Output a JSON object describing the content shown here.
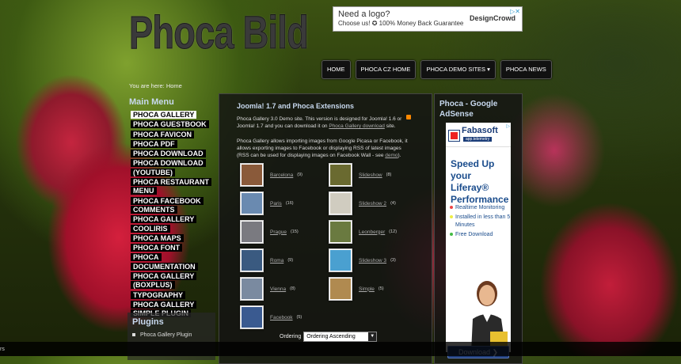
{
  "site": {
    "logo": "Phoca Bild"
  },
  "topad": {
    "line1": "Need a logo?",
    "line2": "Choose us! ✪ 100% Money Back Guarantee",
    "brand": "DesignCrowd",
    "ad_mark": "▷✕"
  },
  "nav": {
    "items": [
      "HOME",
      "PHOCA CZ HOME",
      "PHOCA DEMO SITES ▾",
      "PHOCA NEWS"
    ]
  },
  "breadcrumb": "You are here: Home",
  "mainmenu": {
    "title": "Main Menu",
    "items": [
      "PHOCA GALLERY",
      "PHOCA GUESTBOOK",
      "PHOCA FAVICON",
      "PHOCA PDF",
      "PHOCA DOWNLOAD",
      "PHOCA DOWNLOAD (YOUTUBE)",
      "PHOCA RESTAURANT MENU",
      "PHOCA FACEBOOK COMMENTS",
      "PHOCA GALLERY COOLIRIS",
      "PHOCA MAPS",
      "PHOCA FONT",
      "PHOCA DOCUMENTATION",
      "PHOCA GALLERY (BOXPLUS)",
      "TYPOGRAPHY",
      "PHOCA GALLERY SIMPLE PLUGIN"
    ]
  },
  "plugins": {
    "title": "Plugins",
    "item": "Phoca Gallery Plugin"
  },
  "content": {
    "title": "Joomla! 1.7 and Phoca Extensions",
    "p1": "Phoca Gallery 3.0 Demo site. This version is designed for Joomla! 1.6 or Joomla! 1.7 and you can download it on ",
    "p1_link": "Phoca Gallery download",
    "p1_end": " site.",
    "p2": "Phoca Gallery allows importing images from Google Picasa or Facebook, it allows exporting images to Facebook or displaying RSS of latest images (RSS can be used for displaying images on Facebook Wall - see ",
    "p2_link": "demo",
    "p2_end": ").",
    "categories": [
      {
        "name": "Barcelona",
        "count": "(9)",
        "color": "#8a5a3a"
      },
      {
        "name": "Slideshow",
        "count": "(8)",
        "color": "#6a6a30"
      },
      {
        "name": "Paris",
        "count": "(16)",
        "color": "#6a8ab0"
      },
      {
        "name": "Slideshow 2",
        "count": "(4)",
        "color": "#d0ccc0"
      },
      {
        "name": "Prague",
        "count": "(15)",
        "color": "#7a7a80"
      },
      {
        "name": "Leonberger",
        "count": "(12)",
        "color": "#6a7a40"
      },
      {
        "name": "Roma",
        "count": "(9)",
        "color": "#3a5a80"
      },
      {
        "name": "Slideshow 3",
        "count": "(3)",
        "color": "#4aa0d0"
      },
      {
        "name": "Vienna",
        "count": "(8)",
        "color": "#7a8aa0"
      },
      {
        "name": "Simple",
        "count": "(5)",
        "color": "#b08a50"
      },
      {
        "name": "Facebook",
        "count": "(5)",
        "color": "#3a5a90"
      }
    ],
    "ordering_label": "Ordering",
    "ordering_value": "Ordering Ascending"
  },
  "rightcol": {
    "title": "Phoca - Google AdSense",
    "ad": {
      "brand": "Fabasoft",
      "brand_sub": "app.telemetry",
      "headline": "Speed Up your Liferay® Performance",
      "features": [
        "Realtime Monitoring",
        "Installed in less than 5 Minutes",
        "Free Download"
      ],
      "button": "Download ❯",
      "ad_mark": "▷"
    }
  },
  "statusbar": {
    "text": "rs"
  }
}
